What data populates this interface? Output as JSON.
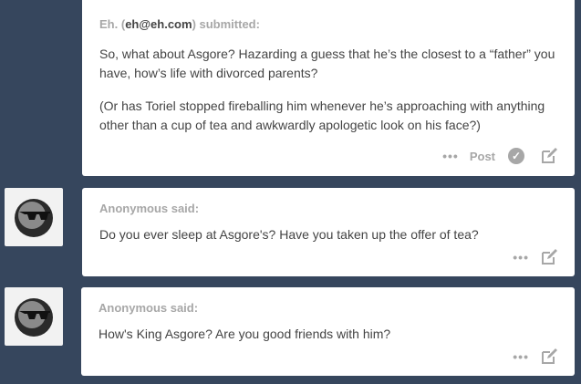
{
  "posts": [
    {
      "sender_name": "Eh.",
      "sender_email": "eh@eh.com",
      "header_suffix": "submitted:",
      "paragraphs": [
        "So, what about Asgore? Hazarding a guess that he’s the closest to a “father” you have, how’s life with divorced parents?",
        "(Or has Toriel stopped fireballing him whenever he’s approaching with anything other than a cup of tea and awkwardly apologetic look on his face?)"
      ],
      "actions": {
        "more": "•••",
        "post": "Post",
        "approve_icon": "check-icon",
        "edit_icon": "edit-icon"
      }
    },
    {
      "header": "Anonymous said:",
      "text": "Do you ever sleep at Asgore's? Have you taken up the offer of tea?",
      "actions": {
        "more": "•••",
        "edit_icon": "edit-icon"
      }
    },
    {
      "header": "Anonymous said:",
      "text": "How's King Asgore? Are you good friends with him?",
      "actions": {
        "more": "•••",
        "edit_icon": "edit-icon"
      }
    }
  ]
}
